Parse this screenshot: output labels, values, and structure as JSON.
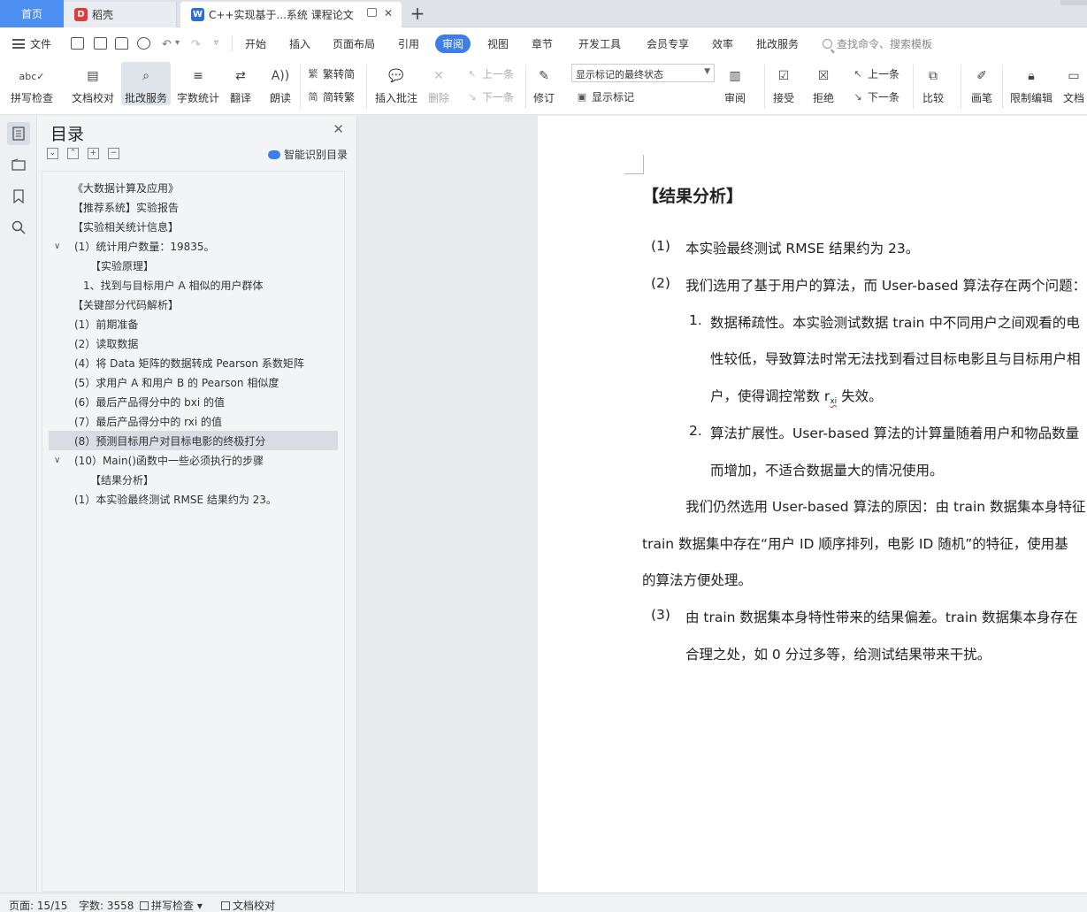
{
  "tabs": {
    "home": "首页",
    "daoke": "稻壳",
    "doc": "C++实现基于...系统 课程论文",
    "add": "+"
  },
  "menubar": {
    "file": "文件",
    "items": [
      "开始",
      "插入",
      "页面布局",
      "引用",
      "审阅",
      "视图",
      "章节",
      "开发工具",
      "会员专享",
      "效率",
      "批改服务"
    ],
    "active": "审阅",
    "search": "查找命令、搜索模板"
  },
  "ribbon": {
    "spellcheck": "拼写检查",
    "doc_check": "文档校对",
    "correction": "批改服务",
    "word_count": "字数统计",
    "translate": "翻译",
    "read_aloud": "朗读",
    "trad_to_simp": "繁转简",
    "simp_to_trad": "简转繁",
    "insert_comment": "插入批注",
    "delete": "删除",
    "prev_comment": "上一条",
    "next_comment": "下一条",
    "revise": "修订",
    "mark_state": "显示标记的最终状态",
    "show_marks": "显示标记",
    "review": "审阅",
    "accept": "接受",
    "reject": "拒绝",
    "prev_change": "上一条",
    "next_change": "下一条",
    "compare": "比较",
    "pen": "画笔",
    "restrict_edit": "限制编辑",
    "doc_rights": "文档"
  },
  "toc": {
    "title": "目录",
    "smart": "智能识别目录",
    "items": [
      "《大数据计算及应用》",
      "【推荐系统】实验报告",
      "【实验相关统计信息】",
      "(1）统计用户数量：19835。",
      "【实验原理】",
      "1、找到与目标用户 A 相似的用户群体",
      "【关键部分代码解析】",
      "(1）前期准备",
      "(2）读取数据",
      "(4）将 Data 矩阵的数据转成 Pearson 系数矩阵",
      "(5）求用户 A 和用户 B 的 Pearson 相似度",
      "(6）最后产品得分中的 bxi 的值",
      "(7）最后产品得分中的 rxi 的值",
      "(8）预测目标用户对目标电影的终极打分",
      "(10）Main()函数中一些必须执行的步骤",
      "【结果分析】",
      "(1）本实验最终测试 RMSE 结果约为 23。"
    ],
    "selected_index": 13
  },
  "document": {
    "heading": "【结果分析】",
    "p1_num": "(1)",
    "p1": "本实验最终测试 RMSE 结果约为 23。",
    "p2_num": "(2)",
    "p2": "我们选用了基于用户的算法，而 User-based 算法存在两个问题：",
    "l1_num": "1.",
    "l1_a": "数据稀疏性。本实验测试数据 train 中不同用户之间观看的电",
    "l1_b": "性较低，导致算法时常无法找到看过目标电影且与目标用户相",
    "l1_c_pre": "户，使得调控常数 r",
    "l1_c_sub": "xi",
    "l1_c_post": " 失效。",
    "l2_num": "2.",
    "l2_a": "算法扩展性。User-based 算法的计算量随着用户和物品数量",
    "l2_b": "而增加，不适合数据量大的情况使用。",
    "p3_a": "我们仍然选用 User-based 算法的原因：由 train 数据集本身特征",
    "p3_b": "train 数据集中存在“用户 ID 顺序排列，电影 ID 随机”的特征，使用基",
    "p3_c": "的算法方便处理。",
    "p4_num": "(3)",
    "p4_a": "由 train 数据集本身特性带来的结果偏差。train 数据集本身存在",
    "p4_b": "合理之处，如 0 分过多等，给测试结果带来干扰。"
  },
  "status": {
    "page": "页面: 15/15",
    "words": "字数: 3558",
    "spell": "拼写检查",
    "proof": "文档校对"
  }
}
